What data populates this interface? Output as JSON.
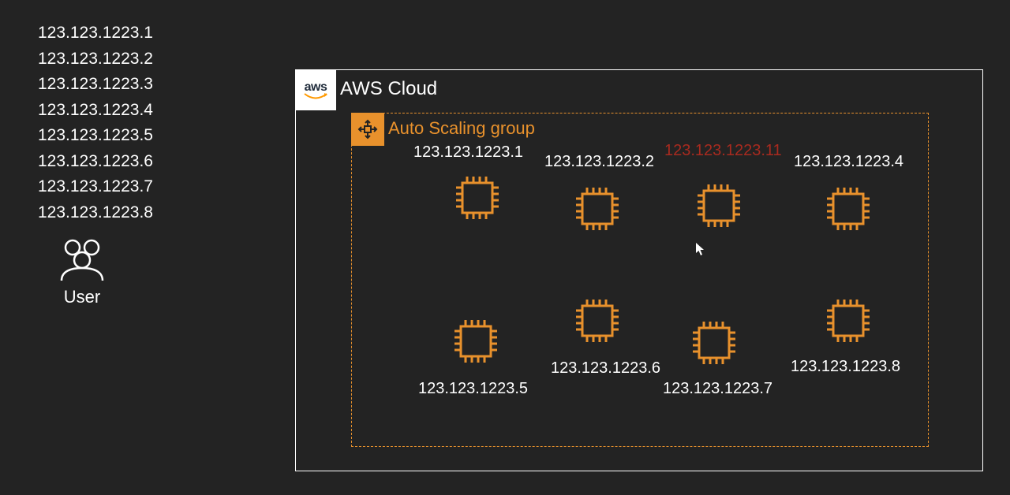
{
  "ip_list": [
    "123.123.1223.1",
    "123.123.1223.2",
    "123.123.1223.3",
    "123.123.1223.4",
    "123.123.1223.5",
    "123.123.1223.6",
    "123.123.1223.7",
    "123.123.1223.8"
  ],
  "user_label": "User",
  "cloud_title": "AWS Cloud",
  "aws_logo_text": "aws",
  "asg_title": "Auto Scaling group",
  "instances": {
    "i1": "123.123.1223.1",
    "i2": "123.123.1223.2",
    "i3_failed": "123.123.1223.11",
    "i4": "123.123.1223.4",
    "i5": "123.123.1223.5",
    "i6": "123.123.1223.6",
    "i7": "123.123.1223.7",
    "i8": "123.123.1223.8"
  },
  "colors": {
    "accent": "#e8912c",
    "failed": "#a82a1f",
    "bg": "#232323"
  }
}
